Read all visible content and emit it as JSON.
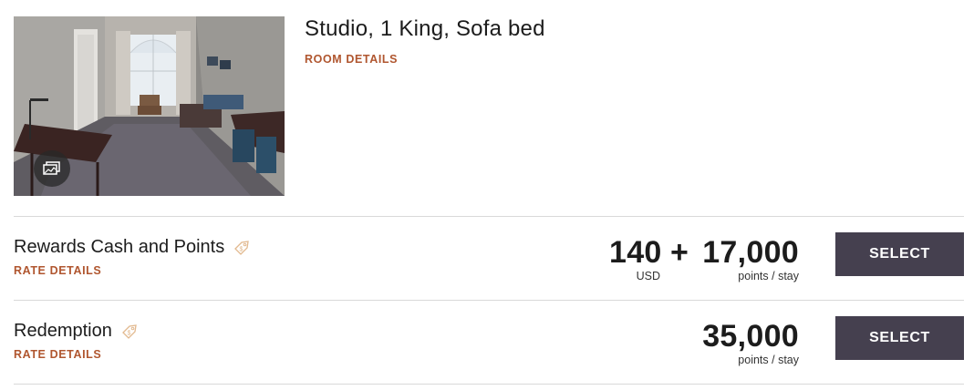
{
  "room": {
    "title": "Studio, 1 King, Sofa bed",
    "details_link": "ROOM DETAILS",
    "photo_icon": "gallery-icon"
  },
  "rates": [
    {
      "name": "Rewards Cash and Points",
      "details_link": "RATE DETAILS",
      "tag_icon": "price-tag-icon",
      "cash_amount": "140",
      "cash_currency": "USD",
      "plus": "+",
      "points": "17,000",
      "points_label": "points / stay",
      "select_label": "SELECT"
    },
    {
      "name": "Redemption",
      "details_link": "RATE DETAILS",
      "tag_icon": "price-tag-icon",
      "points": "35,000",
      "points_label": "points / stay",
      "select_label": "SELECT"
    }
  ],
  "colors": {
    "link": "#b0562f",
    "button": "#45404f",
    "divider": "#d9d9d9"
  }
}
